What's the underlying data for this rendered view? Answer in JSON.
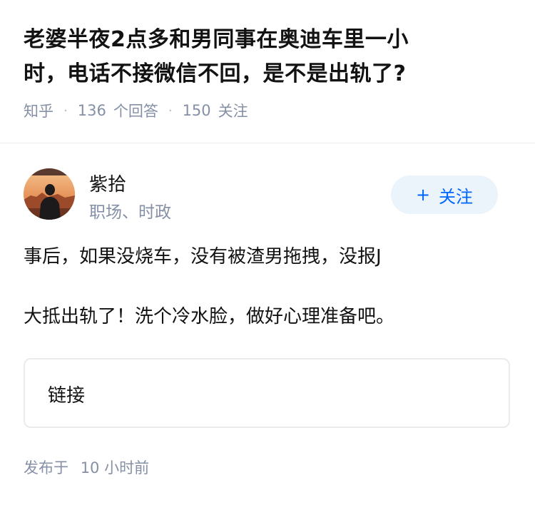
{
  "question": {
    "title_line1": "老婆半夜2点多和男同事在奥迪车里一小",
    "title_line2": "时，电话不接微信不回，是不是出轨了?",
    "source": "知乎",
    "answer_count": "136",
    "answer_label": "个回答",
    "follower_count": "150",
    "follower_label": "关注"
  },
  "author": {
    "name": "紫拾",
    "tags": "职场、时政",
    "avatar_icon": "avatar-photo-icon",
    "follow_label": "关注",
    "follow_icon": "plus-icon"
  },
  "answer": {
    "paragraph1": "事后，如果没烧车，没有被渣男拖拽，没报J",
    "paragraph2": "大抵出轨了！洗个冷水脸，做好心理准备吧。",
    "link_label": "链接",
    "publish_label": "发布于",
    "publish_time": "10 小时前"
  },
  "colors": {
    "title": "#121212",
    "meta": "#8590a6",
    "accent": "#0066ff",
    "follow_bg": "#ebf3fb",
    "border": "#ebebeb"
  }
}
